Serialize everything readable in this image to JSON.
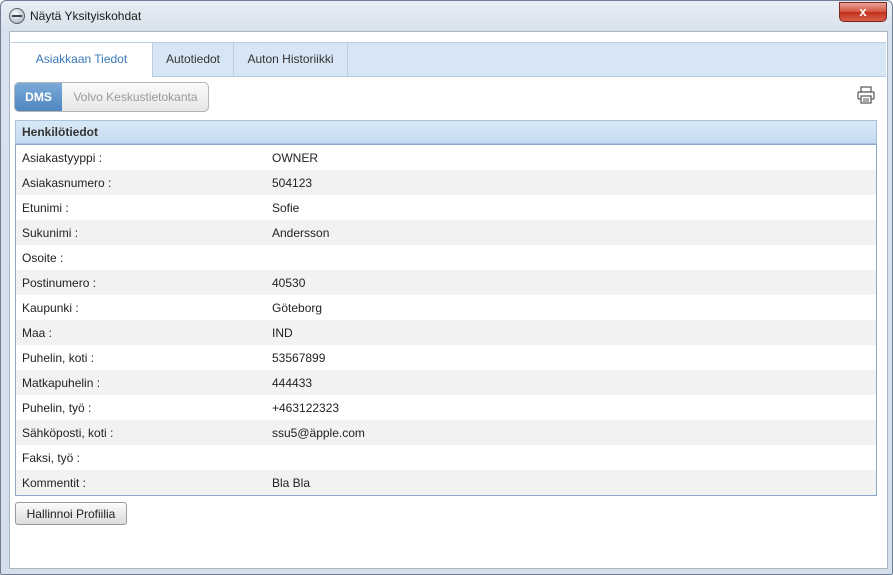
{
  "window": {
    "title": "Näytä Yksityiskohdat",
    "close_label": "x"
  },
  "tabs": [
    {
      "label": "Asiakkaan Tiedot",
      "active": true
    },
    {
      "label": "Autotiedot",
      "active": false
    },
    {
      "label": "Auton Historiikki",
      "active": false
    }
  ],
  "source_toggle": {
    "dms_label": "DMS",
    "volvo_label": "Volvo Keskustietokanta",
    "selected": "DMS"
  },
  "toolbar": {
    "print_icon": "printer-icon"
  },
  "section": {
    "title": "Henkilötiedot"
  },
  "fields": [
    {
      "label": "Asiakastyyppi :",
      "value": "OWNER"
    },
    {
      "label": "Asiakasnumero :",
      "value": "504123"
    },
    {
      "label": "Etunimi :",
      "value": "Sofie"
    },
    {
      "label": "Sukunimi :",
      "value": "Andersson"
    },
    {
      "label": "Osoite :",
      "value": ""
    },
    {
      "label": "Postinumero :",
      "value": "40530"
    },
    {
      "label": "Kaupunki :",
      "value": "Göteborg"
    },
    {
      "label": "Maa :",
      "value": "IND"
    },
    {
      "label": "Puhelin, koti :",
      "value": "53567899"
    },
    {
      "label": "Matkapuhelin :",
      "value": "444433"
    },
    {
      "label": "Puhelin, työ :",
      "value": "+463122323"
    },
    {
      "label": "Sähköposti, koti :",
      "value": "ssu5@äpple.com"
    },
    {
      "label": "Faksi, työ :",
      "value": ""
    },
    {
      "label": "Kommentit :",
      "value": "Bla Bla"
    }
  ],
  "footer": {
    "manage_profile_label": "Hallinnoi Profiilia"
  },
  "colors": {
    "accent": "#4f86c0",
    "tab_active_text": "#3a78b8",
    "header_bg": "#c7dcf1"
  }
}
